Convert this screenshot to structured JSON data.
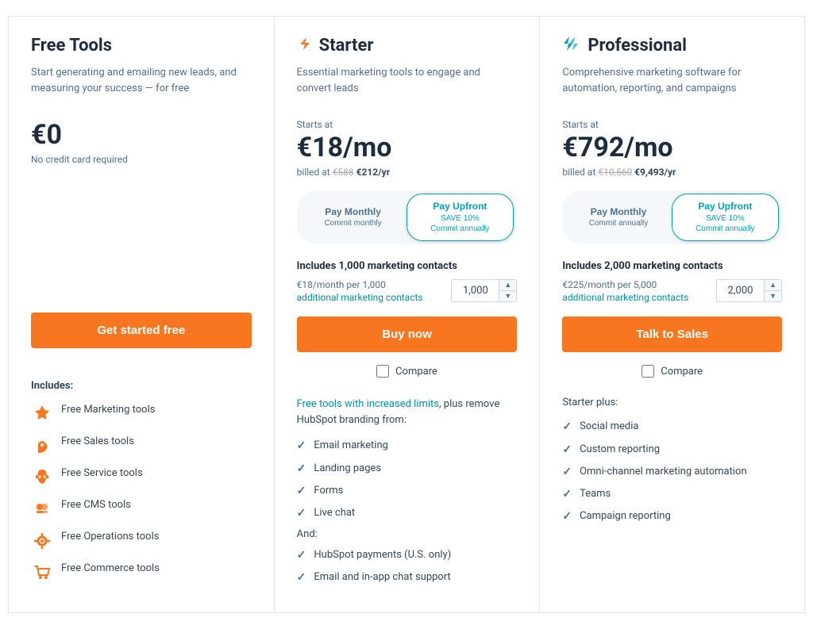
{
  "plans": [
    {
      "id": "free",
      "title": "Free Tools",
      "icon": null,
      "description": "Start generating and emailing new leads, and measuring your success — for free",
      "starts_at": false,
      "price": "€0",
      "price_suffix": "",
      "price_billed": "No credit card required",
      "has_toggle": false,
      "has_contacts": false,
      "cta_label": "Get started free",
      "has_compare": false,
      "includes_label": "Includes:",
      "features_type": "icons",
      "features": [
        {
          "label": "Free Marketing tools",
          "icon": "marketing"
        },
        {
          "label": "Free Sales tools",
          "icon": "sales"
        },
        {
          "label": "Free Service tools",
          "icon": "service"
        },
        {
          "label": "Free CMS tools",
          "icon": "cms"
        },
        {
          "label": "Free Operations tools",
          "icon": "operations"
        },
        {
          "label": "Free Commerce tools",
          "icon": "commerce"
        }
      ]
    },
    {
      "id": "starter",
      "title": "Starter",
      "icon": "bolt",
      "description": "Essential marketing tools to engage and convert leads",
      "starts_at": true,
      "price": "€18/mo",
      "price_billed_strike": "€588",
      "price_billed_value": "€212/yr",
      "toggle": {
        "monthly_label": "Pay Monthly",
        "monthly_sub": "Commit monthly",
        "upfront_label": "Pay Upfront",
        "upfront_sub_save": "SAVE 10%",
        "upfront_sub_commit": "Commit annually",
        "active": "upfront"
      },
      "contacts": {
        "label": "Includes 1,000 marketing contacts",
        "price_info": "€18/month per 1,000",
        "link_text": "additional marketing contacts",
        "value": "1,000"
      },
      "cta_label": "Buy now",
      "has_compare": true,
      "compare_label": "Compare",
      "features_type": "checks",
      "features_intro_link": "Free tools with increased limits",
      "features_intro_suffix": ", plus remove HubSpot branding from:",
      "features_section1": [
        "Email marketing",
        "Landing pages",
        "Forms",
        "Live chat"
      ],
      "and_label": "And:",
      "features_section2": [
        "HubSpot payments (U.S. only)",
        "Email and in-app chat support"
      ]
    },
    {
      "id": "professional",
      "title": "Professional",
      "icon": "bolt-double",
      "description": "Comprehensive marketing software for automation, reporting, and campaigns",
      "starts_at": true,
      "price": "€792/mo",
      "price_billed_strike": "€10,560",
      "price_billed_value": "€9,493/yr",
      "toggle": {
        "monthly_label": "Pay Monthly",
        "monthly_sub": "Commit annually",
        "upfront_label": "Pay Upfront",
        "upfront_sub_save": "SAVE 10%",
        "upfront_sub_commit": "Commit annually",
        "active": "upfront"
      },
      "contacts": {
        "label": "Includes 2,000 marketing contacts",
        "price_info": "€225/month per 5,000",
        "link_text": "additional marketing contacts",
        "value": "2,000"
      },
      "cta_label": "Talk to Sales",
      "has_compare": true,
      "compare_label": "Compare",
      "features_type": "checks",
      "features_intro": "Starter plus:",
      "features_section1": [
        "Social media",
        "Custom reporting",
        "Omni-channel marketing automation",
        "Teams",
        "Campaign reporting"
      ]
    }
  ],
  "icons": {
    "bolt_symbol": "⚡",
    "check_symbol": "✓",
    "up_arrow": "▲",
    "down_arrow": "▼"
  }
}
